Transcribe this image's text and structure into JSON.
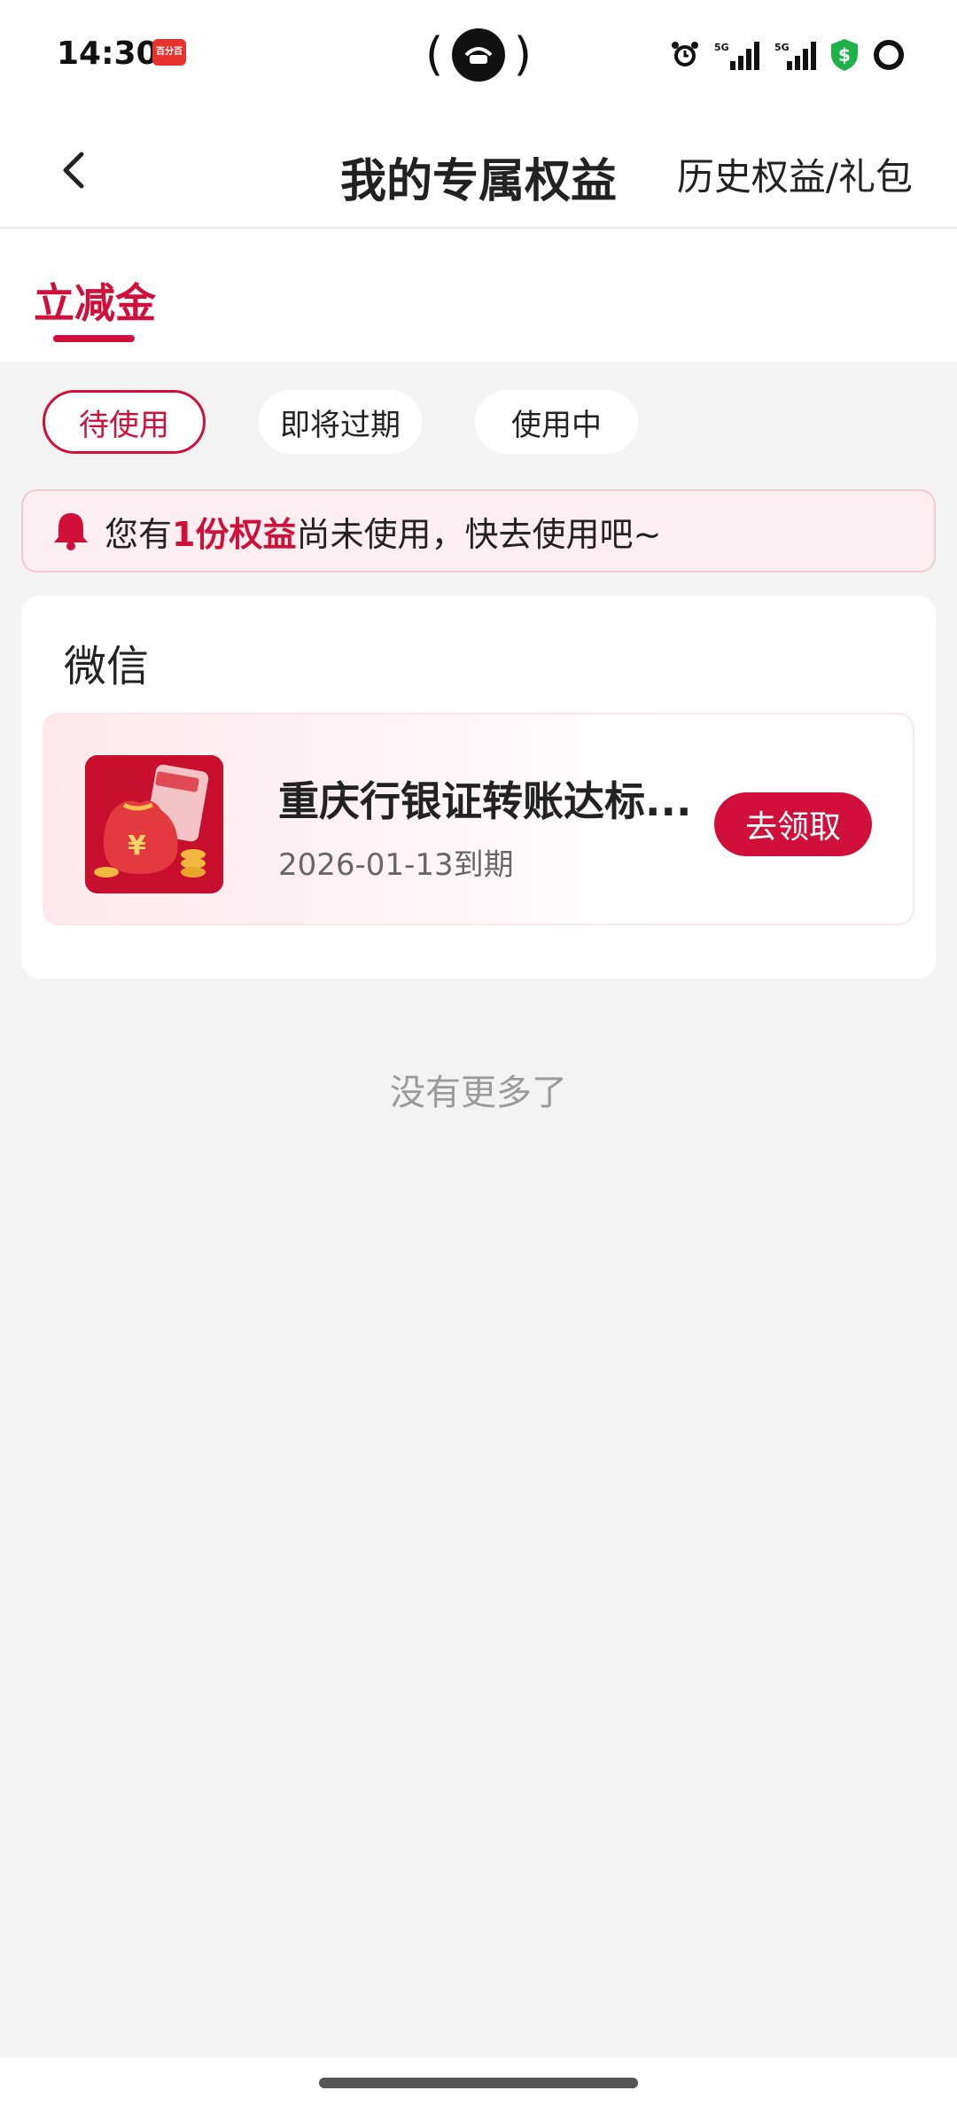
{
  "status_bar": {
    "time": "14:30",
    "app_badge": "百分百",
    "icons": [
      "alarm-icon",
      "signal-5g-icon",
      "signal-5g-icon",
      "shield-dollar-icon",
      "battery-ring-icon"
    ],
    "network_label": "5G"
  },
  "header": {
    "title": "我的专属权益",
    "history_link": "历史权益/礼包"
  },
  "tabs": {
    "active_label": "立减金"
  },
  "filters": {
    "items": [
      "待使用",
      "即将过期",
      "使用中"
    ],
    "selected": "待使用"
  },
  "notice": {
    "prefix": "您有",
    "highlight": "1份权益",
    "suffix": "尚未使用，快去使用吧~"
  },
  "section": {
    "title": "微信",
    "coupon": {
      "title": "重庆行银证转账达标...",
      "expiry": "2026-01-13到期",
      "button_label": "去领取"
    }
  },
  "footer": {
    "no_more": "没有更多了"
  },
  "colors": {
    "accent": "#d0103a",
    "background": "#f3f3f3",
    "notice_bg": "#fdeff1"
  }
}
